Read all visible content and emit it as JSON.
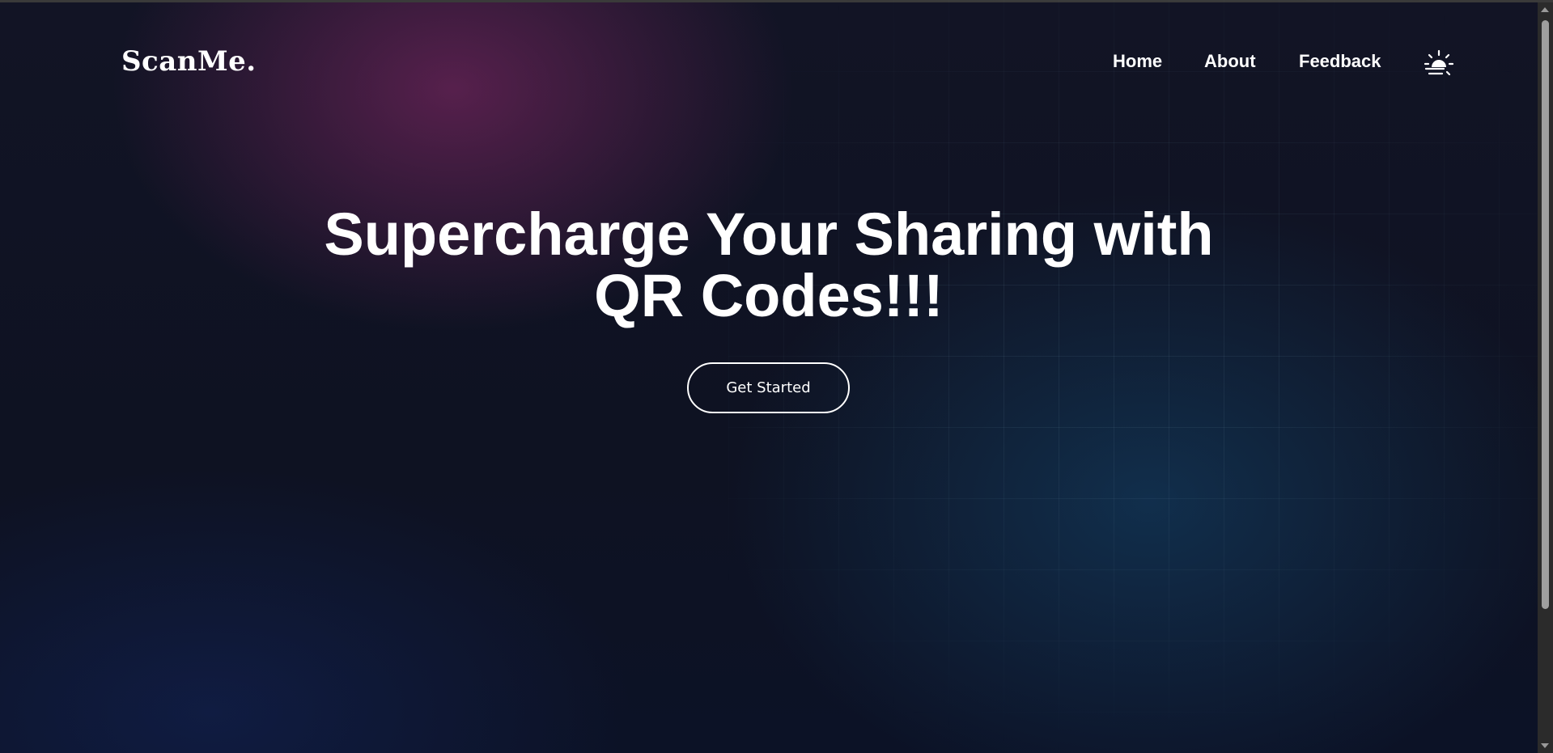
{
  "brand": {
    "logo_text": "ScanMe."
  },
  "nav": {
    "items": [
      {
        "label": "Home"
      },
      {
        "label": "About"
      },
      {
        "label": "Feedback"
      }
    ],
    "theme_toggle_icon": "sunset-icon"
  },
  "hero": {
    "title_line1": "Supercharge Your Sharing with",
    "title_line2": "QR Codes!!!",
    "cta_label": "Get Started"
  },
  "colors": {
    "text": "#ffffff",
    "background": "#0d1020",
    "glow_accent": "#6e245a",
    "glow_secondary": "#14466e"
  }
}
